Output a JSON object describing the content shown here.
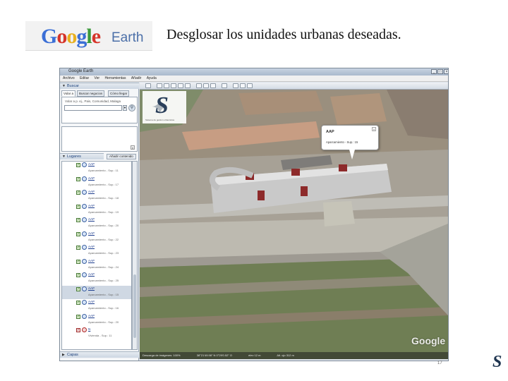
{
  "slide": {
    "title": "Desglosar los unidades urbanas deseadas.",
    "logo": {
      "word_parts": [
        "G",
        "o",
        "o",
        "g",
        "l",
        "e"
      ],
      "suffix": "Earth"
    }
  },
  "window": {
    "title": "Google Earth",
    "controls": [
      "_",
      "□",
      "×"
    ],
    "menu": [
      "Archivo",
      "Editar",
      "Ver",
      "Herramientas",
      "Añadir",
      "Ayuda"
    ]
  },
  "sidebar": {
    "search": {
      "header": "Buscar",
      "tabs": [
        "Volar a",
        "Buscar negocios",
        "Cómo llegar"
      ],
      "hint": "Volar a p. ej., Pais, Comunidad, Malaga",
      "go_icon": "search-icon"
    },
    "places": {
      "header": "Lugares",
      "add_content": "Añadir contenido",
      "items": [
        {
          "name": "AAP",
          "desc": "Aparcamiento - Sup.: 11"
        },
        {
          "name": "AAP",
          "desc": "Aparcamiento - Sup.: 17"
        },
        {
          "name": "AAP",
          "desc": "Aparcamiento - Sup.: 18"
        },
        {
          "name": "AAP",
          "desc": "Aparcamiento - Sup.: 19"
        },
        {
          "name": "AAP",
          "desc": "Aparcamiento - Sup.: 20"
        },
        {
          "name": "AAP",
          "desc": "Aparcamiento - Sup.: 22"
        },
        {
          "name": "AAP",
          "desc": "Aparcamiento - Sup.: 23"
        },
        {
          "name": "AAP",
          "desc": "Aparcamiento - Sup.: 24"
        },
        {
          "name": "AAP",
          "desc": "Aparcamiento - Sup.: 25"
        },
        {
          "name": "AAP",
          "desc": "Aparcamiento - Sup.: 15",
          "selected": true
        },
        {
          "name": "AAP",
          "desc": "Aparcamiento - Sup.: 16"
        },
        {
          "name": "AAP",
          "desc": "Aparcamiento - Sup.: 20"
        },
        {
          "name": "N",
          "desc": "Vivienda - Sup.: 11",
          "alt": true
        }
      ]
    },
    "layers": {
      "header": "Capas"
    }
  },
  "map": {
    "balloon": {
      "title": "AAP",
      "body": "Aparcamiento - Sup.: 15",
      "close": "×"
    },
    "compass_caption": "Sistema de gestión urbanística",
    "watermark": "Google",
    "status": [
      "Descarga de imágenes: 100%",
      "38°21'49.98\" N   0°29'0.52\" O",
      "elev 12 m",
      "Alt. ojo 312 m"
    ]
  },
  "page_number": "17"
}
